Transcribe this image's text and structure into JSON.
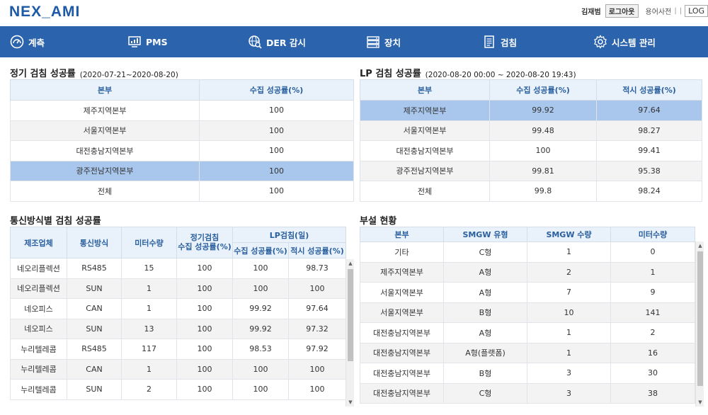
{
  "header": {
    "logo": "NEX_AMI",
    "username": "김재범",
    "logout_label": "로그아웃",
    "dict_label": "용어사전",
    "separator": "|",
    "log_label": "LOG"
  },
  "nav": [
    {
      "label": "계측",
      "icon": "gauge-icon"
    },
    {
      "label": "PMS",
      "icon": "monitor-chart-icon"
    },
    {
      "label": "DER 감시",
      "icon": "globe-search-icon"
    },
    {
      "label": "장치",
      "icon": "server-icon"
    },
    {
      "label": "검침",
      "icon": "document-icon"
    },
    {
      "label": "시스템 관리",
      "icon": "gear-icon"
    }
  ],
  "regular": {
    "title": "정기 검침 성공률",
    "period": "(2020-07-21~2020-08-20)",
    "headers": [
      "본부",
      "수집 성공률(%)"
    ],
    "rows": [
      [
        "제주지역본부",
        "100"
      ],
      [
        "서울지역본부",
        "100"
      ],
      [
        "대전충남지역본부",
        "100"
      ],
      [
        "광주전남지역본부",
        "100"
      ],
      [
        "전체",
        "100"
      ]
    ]
  },
  "lp": {
    "title": "LP 검침 성공률",
    "period": "(2020-08-20 00:00 ~ 2020-08-20 19:43)",
    "headers": [
      "본부",
      "수집 성공률(%)",
      "적시 성공률(%)"
    ],
    "rows": [
      [
        "제주지역본부",
        "99.92",
        "97.64"
      ],
      [
        "서울지역본부",
        "99.48",
        "98.27"
      ],
      [
        "대전충남지역본부",
        "100",
        "99.41"
      ],
      [
        "광주전남지역본부",
        "99.81",
        "95.38"
      ],
      [
        "전체",
        "99.8",
        "98.24"
      ]
    ]
  },
  "comm": {
    "title": "통신방식별 검침 성공률",
    "headers": {
      "maker": "제조업체",
      "method": "통신방식",
      "meters": "미터수량",
      "regular_line1": "정기검침",
      "regular_line2": "수집 성공률(%)",
      "lp_group": "LP검침(일)",
      "lp_collect": "수집 성공률(%)",
      "lp_timely": "적시 성공률(%)"
    },
    "rows": [
      [
        "네오리플렉션",
        "RS485",
        "15",
        "100",
        "100",
        "98.73"
      ],
      [
        "네오리플렉션",
        "SUN",
        "1",
        "100",
        "100",
        "100"
      ],
      [
        "네오피스",
        "CAN",
        "1",
        "100",
        "99.92",
        "97.64"
      ],
      [
        "네오피스",
        "SUN",
        "13",
        "100",
        "99.92",
        "97.32"
      ],
      [
        "누리텔레콤",
        "RS485",
        "117",
        "100",
        "98.53",
        "97.92"
      ],
      [
        "누리텔레콤",
        "CAN",
        "1",
        "100",
        "100",
        "100"
      ],
      [
        "누리텔레콤",
        "SUN",
        "2",
        "100",
        "100",
        "100"
      ]
    ]
  },
  "equip": {
    "title": "부설 현황",
    "headers": [
      "본부",
      "SMGW 유형",
      "SMGW 수량",
      "미터수량"
    ],
    "rows": [
      [
        "기타",
        "C형",
        "1",
        "0"
      ],
      [
        "제주지역본부",
        "A형",
        "2",
        "1"
      ],
      [
        "서울지역본부",
        "A형",
        "7",
        "9"
      ],
      [
        "서울지역본부",
        "B형",
        "10",
        "141"
      ],
      [
        "대전충남지역본부",
        "A형",
        "1",
        "2"
      ],
      [
        "대전충남지역본부",
        "A형(플랫폼)",
        "1",
        "16"
      ],
      [
        "대전충남지역본부",
        "B형",
        "3",
        "30"
      ],
      [
        "대전충남지역본부",
        "C형",
        "3",
        "38"
      ]
    ]
  }
}
